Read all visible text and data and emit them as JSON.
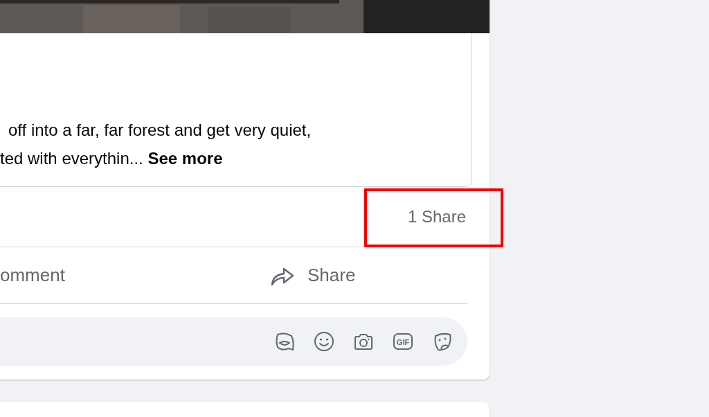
{
  "post_text": {
    "lines": [
      "off into a far, far forest and get very quiet,",
      "ted with everythin..."
    ],
    "see_more": "See more"
  },
  "stats": {
    "shares": "1 Share",
    "highlighted": true
  },
  "actions": [
    {
      "kind": "comment",
      "label": "omment"
    },
    {
      "kind": "share",
      "label": "Share"
    }
  ],
  "comment_box": {
    "icons": [
      {
        "kind": "avatar"
      },
      {
        "kind": "emoji"
      },
      {
        "kind": "camera"
      },
      {
        "kind": "gif",
        "label": "GIF"
      },
      {
        "kind": "sticker"
      }
    ]
  }
}
